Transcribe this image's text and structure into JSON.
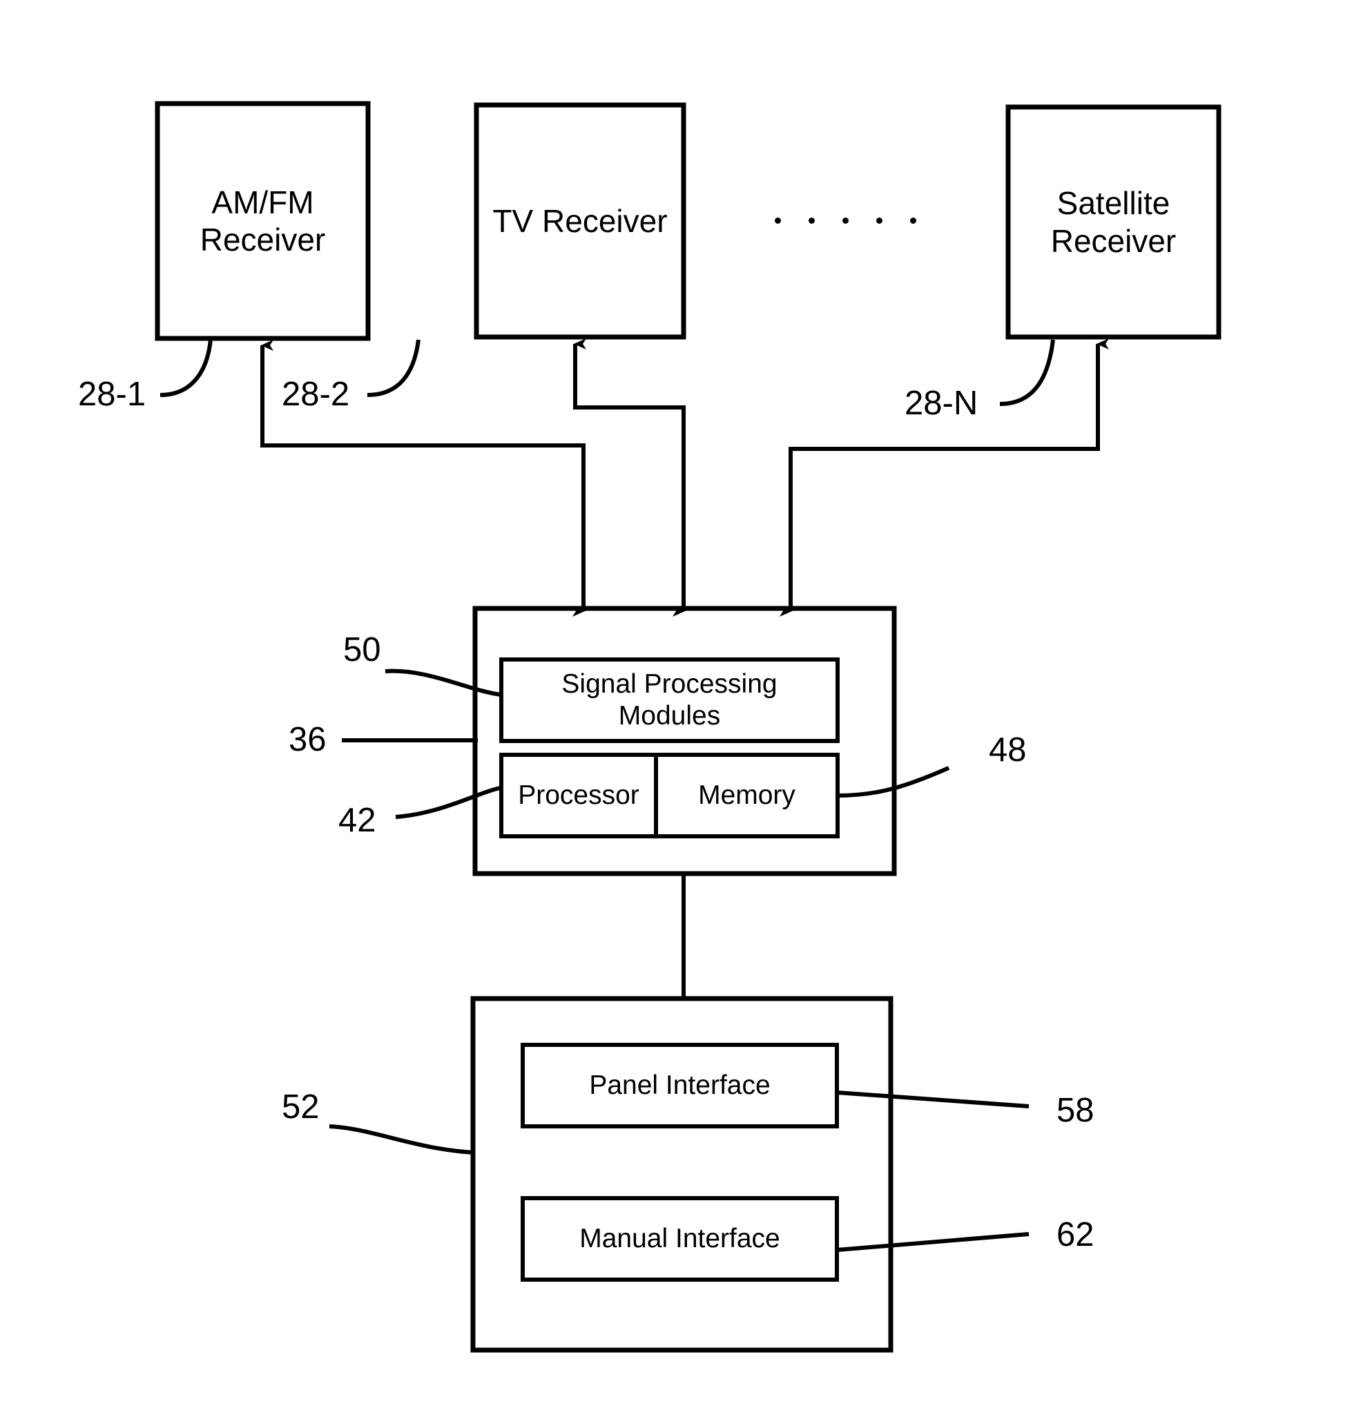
{
  "figure": {
    "type": "patent-block-diagram",
    "stroke_color": "#000000",
    "background_color": "#ffffff"
  },
  "receivers": [
    {
      "label": "AM/FM\nReceiver",
      "ref": "28-1"
    },
    {
      "label": "TV Receiver",
      "ref": "28-2"
    },
    {
      "label": "Satellite\nReceiver",
      "ref": "28-N"
    }
  ],
  "ellipsis": {
    "dot_count": 5
  },
  "head_unit": {
    "ref": "36",
    "modules": [
      {
        "label": "Signal Processing\nModules",
        "ref": "50"
      },
      {
        "label": "Processor",
        "ref": "42"
      },
      {
        "label": "Memory",
        "ref": "48"
      }
    ]
  },
  "control_unit": {
    "ref": "52",
    "modules": [
      {
        "label": "Panel Interface",
        "ref": "58"
      },
      {
        "label": "Manual Interface",
        "ref": "62"
      }
    ]
  }
}
